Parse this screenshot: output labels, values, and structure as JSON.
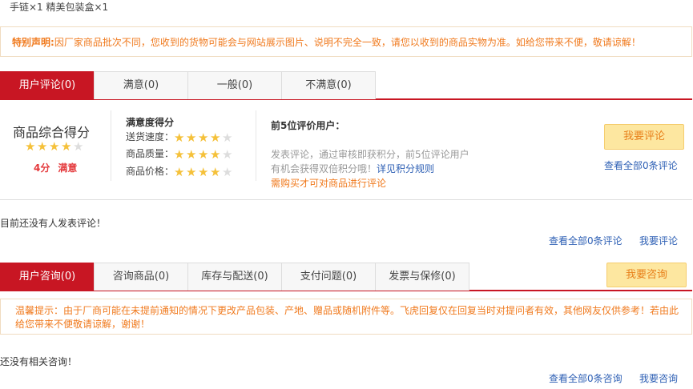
{
  "package_contents": "手链×1 精美包装盒×1",
  "notice": {
    "label": "特别声明:",
    "text": "因厂家商品批次不同，您收到的货物可能会与网站展示图片、说明不完全一致，请您以收到的商品实物为准。如给您带来不便，敬请谅解！"
  },
  "review_tabs": [
    {
      "label": "用户评论(0)"
    },
    {
      "label": "满意(0)"
    },
    {
      "label": "一般(0)"
    },
    {
      "label": "不满意(0)"
    }
  ],
  "score": {
    "title": "商品综合得分",
    "rating": 4,
    "max": 5,
    "value": "4分",
    "level": "满意"
  },
  "satisfaction": {
    "title": "满意度得分",
    "rows": [
      {
        "label": "送货速度：",
        "rating": 4
      },
      {
        "label": "商品质量：",
        "rating": 4
      },
      {
        "label": "商品价格：",
        "rating": 4
      }
    ]
  },
  "top5": {
    "title": "前5位评价用户：",
    "desc_line1": "发表评论，通过审核即获积分，前5位评论用户",
    "desc_line2": "有机会获得双倍积分哦！",
    "rules_link": "详见积分规则",
    "purchase_note": "需购买才可对商品进行评论"
  },
  "review_actions": {
    "write_button": "我要评论",
    "view_all": "查看全部0条评论"
  },
  "review_empty": "目前还没有人发表评论！",
  "review_footer": {
    "view_all": "查看全部0条评论",
    "write": "我要评论"
  },
  "consult_tabs": [
    {
      "label": "用户咨询(0)"
    },
    {
      "label": "咨询商品(0)"
    },
    {
      "label": "库存与配送(0)"
    },
    {
      "label": "支付问题(0)"
    },
    {
      "label": "发票与保修(0)"
    }
  ],
  "consult_button": "我要咨询",
  "warm_tip": {
    "label": "温馨提示：",
    "text": "由于厂商可能在未提前通知的情况下更改产品包装、产地、赠品或随机附件等。飞虎回复仅在回复当时对提问者有效，其他网友仅供参考！若由此给您带来不便敬请谅解，谢谢！"
  },
  "consult_empty": "还没有相关咨询！",
  "consult_footer": {
    "view_all": "查看全部0条咨询",
    "write": "我要咨询"
  },
  "colors": {
    "brand_red": "#c81623",
    "star": "#f5c13a",
    "notice_orange": "#f07a1e",
    "link_blue": "#2d5fb4"
  }
}
